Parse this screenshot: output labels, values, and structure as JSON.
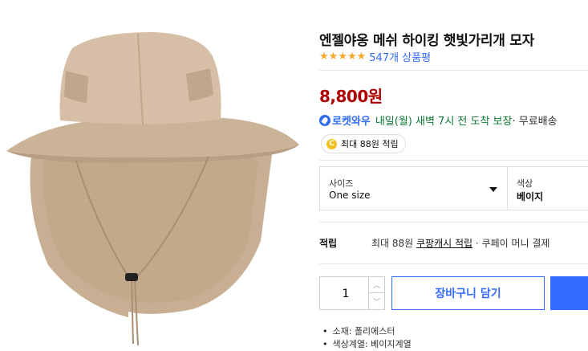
{
  "product": {
    "title": "엔젤야옹 메쉬 하이킹 햇빛가리개 모자",
    "rating_stars": 4.5,
    "review_count_text": "547개 상품평",
    "price": "8,800원"
  },
  "delivery": {
    "badge_label": "로켓와우",
    "eta_text": "내일(월) 새벽 7시 전 도착 보장",
    "shipping_text": " · 무료배송"
  },
  "reward_badge": {
    "coin_symbol": "C",
    "text": "최대 88원 적립"
  },
  "options": [
    {
      "label": "사이즈",
      "value": "One size"
    },
    {
      "label": "색상",
      "value": "베이지"
    }
  ],
  "rewards": {
    "label": "적립",
    "prefix": "최대 88원 ",
    "link": "쿠팡캐시 적립",
    "suffix": " · 쿠페이 머니 결제"
  },
  "purchase": {
    "quantity": "1",
    "cart_label": "장바구니 담기"
  },
  "specs": [
    "소재: 폴리에스터",
    "색상계열: 베이지계열"
  ],
  "colors": {
    "accent": "#346aff",
    "price": "#ae0000",
    "star": "#f7a92b",
    "delivery_green": "#0a7a31",
    "hat_beige": "#cdb49a"
  }
}
